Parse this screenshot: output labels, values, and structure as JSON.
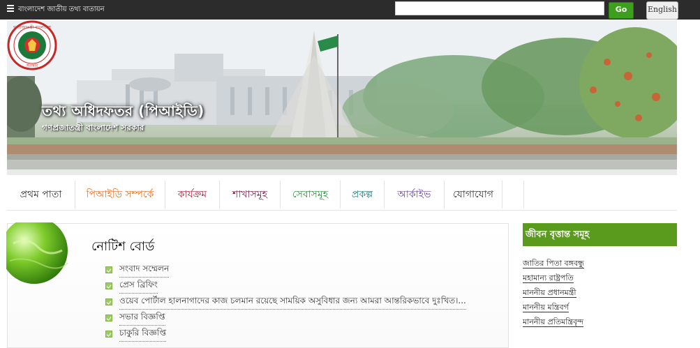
{
  "topbar": {
    "portal_link": "বাংলাদেশ জাতীয় তথ্য বাতায়ন",
    "search_value": "",
    "go_label": "Go",
    "english_label": "English"
  },
  "banner": {
    "title": "তথ্য অধিদফতর (পিআইডি)",
    "subtitle": "গণপ্রজাতন্ত্রী বাংলাদেশ সরকার",
    "emblem_text_top": "গণপ্রজাতন্ত্রী বাংলাদেশ",
    "emblem_text_bottom": "সরকার"
  },
  "nav": [
    {
      "label": "প্রথম পাতা",
      "color": "#333333"
    },
    {
      "label": "পিআইডি সম্পর্কে",
      "color": "#e0701c"
    },
    {
      "label": "কার্যক্রম",
      "color": "#a0283c"
    },
    {
      "label": "শাখাসমূহ",
      "color": "#7a1a4a"
    },
    {
      "label": "সেবাসমূহ",
      "color": "#2f8f3f"
    },
    {
      "label": "প্রকল্প",
      "color": "#1a7a7a"
    },
    {
      "label": "আর্কাইভ",
      "color": "#6a4aa0"
    },
    {
      "label": "যোগাযোগ",
      "color": "#333333"
    },
    {
      "label": "",
      "color": "#333333"
    }
  ],
  "notice_board": {
    "title": "নোটিশ বোর্ড",
    "items": [
      "সংবাদ সম্মেলন",
      "প্রেস ব্রিফিং",
      "ওয়েব পোর্টাল হালনাগাদের কাজ চলমান রয়েছে সাময়িক অসুবিধার জন্য আমরা আন্তরিকভাবে দুঃখিত।...",
      "সভার বিজ্ঞপ্তি",
      "চাকুরি বিজ্ঞপ্তি"
    ]
  },
  "biography": {
    "title": "জীবন বৃত্তান্ত সমূহ",
    "items": [
      "জাতির পিতা বঙ্গবন্ধু",
      "মহামান্য রাষ্ট্রপতি",
      "মাননীয় প্রধানমন্ত্রী",
      "মাননীয় মন্ত্রিবর্গ",
      "মাননীয় প্রতিমন্ত্রিবৃন্দ"
    ]
  },
  "colors": {
    "topbar": "#2c2c2c",
    "go_button": "#3e9e1e",
    "bio_header": "#5a9a1c",
    "bullet": "#9ccc63"
  }
}
